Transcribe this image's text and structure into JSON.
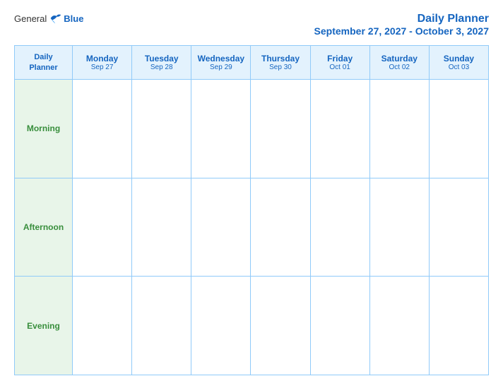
{
  "header": {
    "logo": {
      "general": "General",
      "blue": "Blue"
    },
    "title": "Daily Planner",
    "subtitle": "September 27, 2027 - October 3, 2027"
  },
  "columns": [
    {
      "id": "daily-planner",
      "day": "Daily",
      "day2": "Planner",
      "date": ""
    },
    {
      "id": "mon",
      "day": "Monday",
      "date": "Sep 27"
    },
    {
      "id": "tue",
      "day": "Tuesday",
      "date": "Sep 28"
    },
    {
      "id": "wed",
      "day": "Wednesday",
      "date": "Sep 29"
    },
    {
      "id": "thu",
      "day": "Thursday",
      "date": "Sep 30"
    },
    {
      "id": "fri",
      "day": "Friday",
      "date": "Oct 01"
    },
    {
      "id": "sat",
      "day": "Saturday",
      "date": "Oct 02"
    },
    {
      "id": "sun",
      "day": "Sunday",
      "date": "Oct 03"
    }
  ],
  "rows": [
    {
      "id": "morning",
      "label": "Morning"
    },
    {
      "id": "afternoon",
      "label": "Afternoon"
    },
    {
      "id": "evening",
      "label": "Evening"
    }
  ]
}
